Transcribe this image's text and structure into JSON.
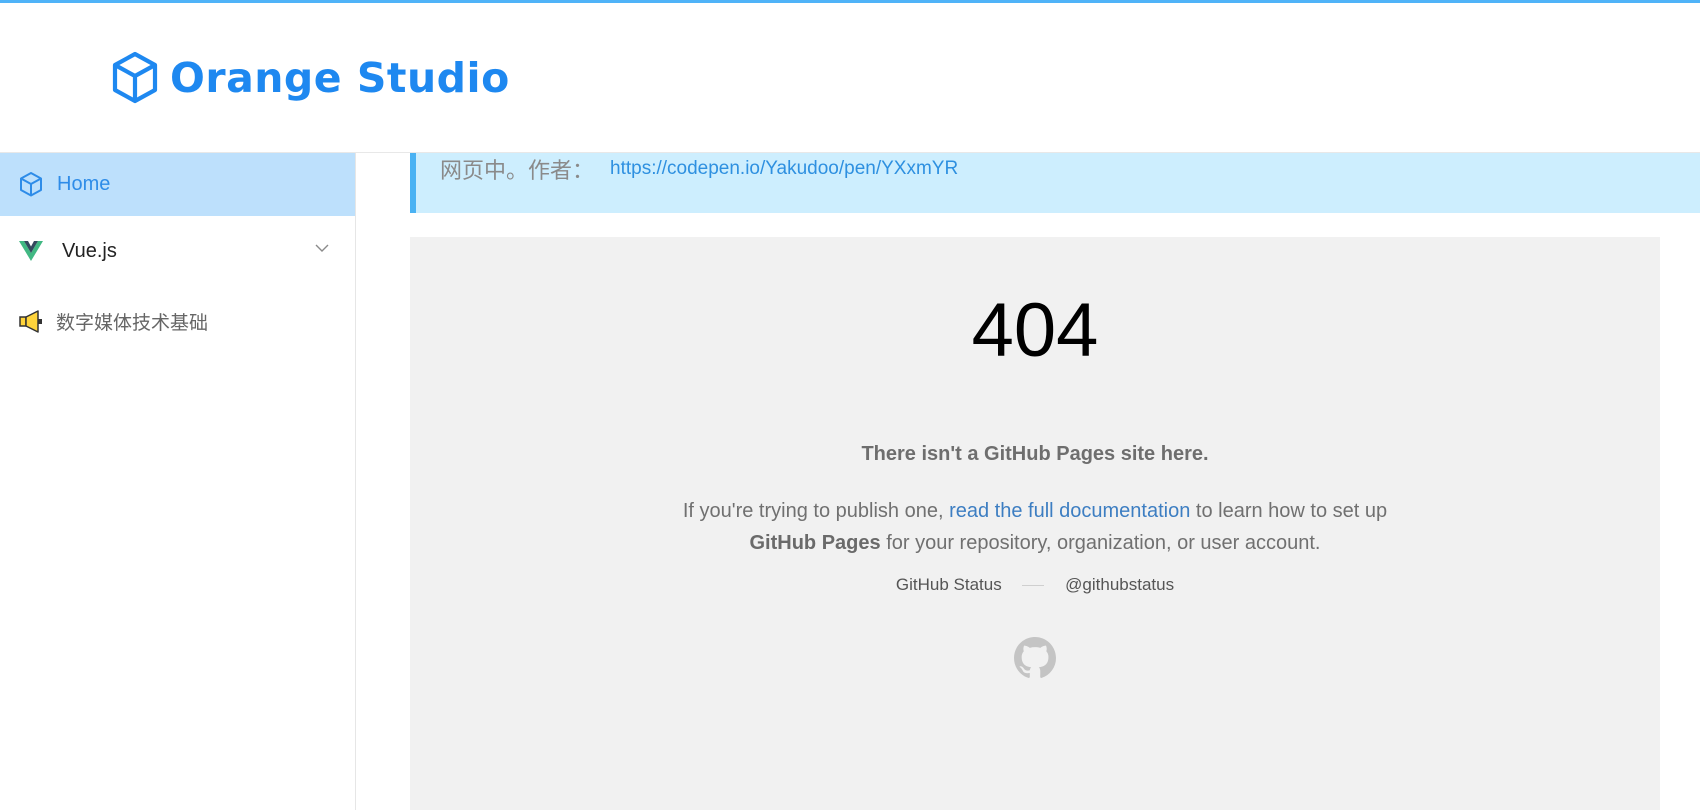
{
  "brand": {
    "name": "Orange Studio",
    "icon": "cube-icon",
    "color": "#1e88f0"
  },
  "sidebar": {
    "items": [
      {
        "label": "Home",
        "icon": "cube-icon",
        "active": true
      },
      {
        "label": "Vue.js",
        "icon": "vue-logo-icon",
        "expandable": true
      },
      {
        "label": "数字媒体技术基础",
        "icon": "megaphone-icon"
      }
    ]
  },
  "notice": {
    "text": "网页中。作者：",
    "link": "https://codepen.io/Yakudoo/pen/YXxmYR"
  },
  "embed": {
    "code": "404",
    "headline": "There isn't a GitHub Pages site here.",
    "desc_prefix": "If you're trying to publish one, ",
    "desc_link": "read the full documentation",
    "desc_middle": " to learn how to set up",
    "desc_bold": "GitHub Pages",
    "desc_suffix": " for your repository, organization, or user account.",
    "status_link": "GitHub Status",
    "twitter_link": "@githubstatus",
    "footer_icon": "github-octocat-icon"
  },
  "colors": {
    "accent": "#4fb3f8",
    "active_nav_bg": "#bde0fc",
    "notice_bg": "#cdeefe",
    "link": "#2e90e0"
  }
}
